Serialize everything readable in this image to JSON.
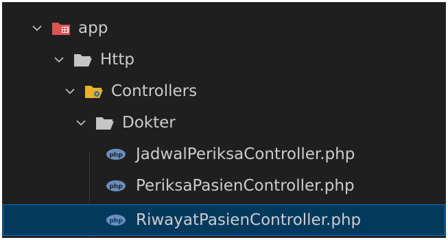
{
  "explorer": {
    "rows": [
      {
        "label": "app",
        "kind": "folder-app",
        "expanded": true
      },
      {
        "label": "Http",
        "kind": "folder",
        "expanded": true
      },
      {
        "label": "Controllers",
        "kind": "folder-controllers",
        "expanded": true
      },
      {
        "label": "Dokter",
        "kind": "folder",
        "expanded": true
      },
      {
        "label": "JadwalPeriksaController.php",
        "kind": "php-file",
        "icon_text": "php"
      },
      {
        "label": "PeriksaPasienController.php",
        "kind": "php-file",
        "icon_text": "php"
      },
      {
        "label": "RiwayatPasienController.php",
        "kind": "php-file",
        "icon_text": "php",
        "selected": true
      }
    ]
  },
  "colors": {
    "background": "#1f1f1f",
    "text": "#cccccc",
    "selected_bg": "#04395e",
    "selected_border": "#0078d4",
    "app_folder": "#e05252",
    "plain_folder": "#c5c5c5",
    "controllers_folder": "#e8b22d",
    "php_icon": "#6c8ebf"
  }
}
